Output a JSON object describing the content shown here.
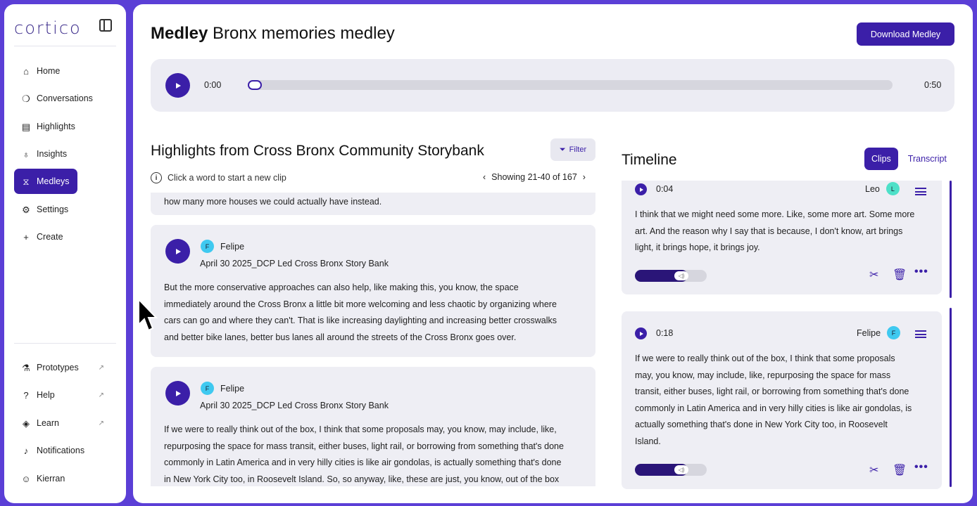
{
  "app": {
    "brand": "cortico",
    "title_bold": "Medley",
    "title_rest": "Bronx memories medley",
    "download_label": "Download Medley"
  },
  "sidebar": {
    "items": [
      {
        "label": "Home",
        "icon": "home-icon"
      },
      {
        "label": "Conversations",
        "icon": "conversations-icon"
      },
      {
        "label": "Highlights",
        "icon": "highlights-icon"
      },
      {
        "label": "Insights",
        "icon": "lightbulb-icon"
      },
      {
        "label": "Medleys",
        "icon": "medleys-icon",
        "active": true
      },
      {
        "label": "Settings",
        "icon": "gear-icon"
      },
      {
        "label": "Create",
        "icon": "plus-icon"
      }
    ],
    "bottom_items": [
      {
        "label": "Prototypes",
        "icon": "flask-icon",
        "external": true
      },
      {
        "label": "Help",
        "icon": "help-icon",
        "external": true
      },
      {
        "label": "Learn",
        "icon": "graduation-cap-icon",
        "external": true
      },
      {
        "label": "Notifications",
        "icon": "bell-icon"
      },
      {
        "label": "Kierran",
        "icon": "user-icon"
      }
    ]
  },
  "player": {
    "current_time": "0:00",
    "duration": "0:50",
    "progress": 0
  },
  "highlights": {
    "title": "Highlights from Cross Bronx Community Storybank",
    "filter_label": "Filter",
    "hint": "Click a word to start a new clip",
    "pager": "Showing 21-40 of 167",
    "partial_text": "how many more houses we could actually have instead.",
    "cards": [
      {
        "speaker": "Felipe",
        "avatar_letter": "F",
        "source": "April 30 2025_DCP Led Cross Bronx Story Bank",
        "lines": [
          "But the more conservative approaches can also help, like making this, you know, the space",
          "immediately around the Cross Bronx a little bit more welcoming and less chaotic by organizing where",
          "cars can go and where they can't. That is like increasing daylighting and increasing better crosswalks",
          "and better bike lanes, better bus lanes all around the streets of the Cross Bronx goes over."
        ]
      },
      {
        "speaker": "Felipe",
        "avatar_letter": "F",
        "source": "April 30 2025_DCP Led Cross Bronx Story Bank",
        "lines": [
          "If we were to really think out of the box, I think that some proposals may, you know, may include, like,",
          "repurposing the space for mass transit, either buses, light rail, or borrowing from something that's done",
          "commonly in Latin America and in very hilly cities is like air gondolas, is actually something that's done",
          "in New York City too, in Roosevelt Island. So, so anyway, like, these are just, you know, out of the box"
        ]
      }
    ]
  },
  "timeline": {
    "title": "Timeline",
    "tab_clips": "Clips",
    "tab_transcript": "Transcript",
    "clips": [
      {
        "time": "0:04",
        "speaker": "Leo",
        "avatar_letter": "L",
        "lines": [
          "I think that we might need some more. Like, some more art. Some more",
          "art. And the reason why I say that is because, I don't know, art brings",
          "light, it brings hope, it brings joy."
        ],
        "volume": 0.73
      },
      {
        "time": "0:18",
        "speaker": "Felipe",
        "avatar_letter": "F",
        "lines": [
          "If we were to really think out of the box, I think that some proposals",
          "may, you know, may include, like, repurposing the space for mass",
          "transit, either buses, light rail, or borrowing from something that's done",
          "commonly in Latin America and in very hilly cities is like air gondolas, is",
          "actually something that's done in New York City too, in Roosevelt",
          "Island."
        ],
        "volume": 0.73
      }
    ]
  }
}
